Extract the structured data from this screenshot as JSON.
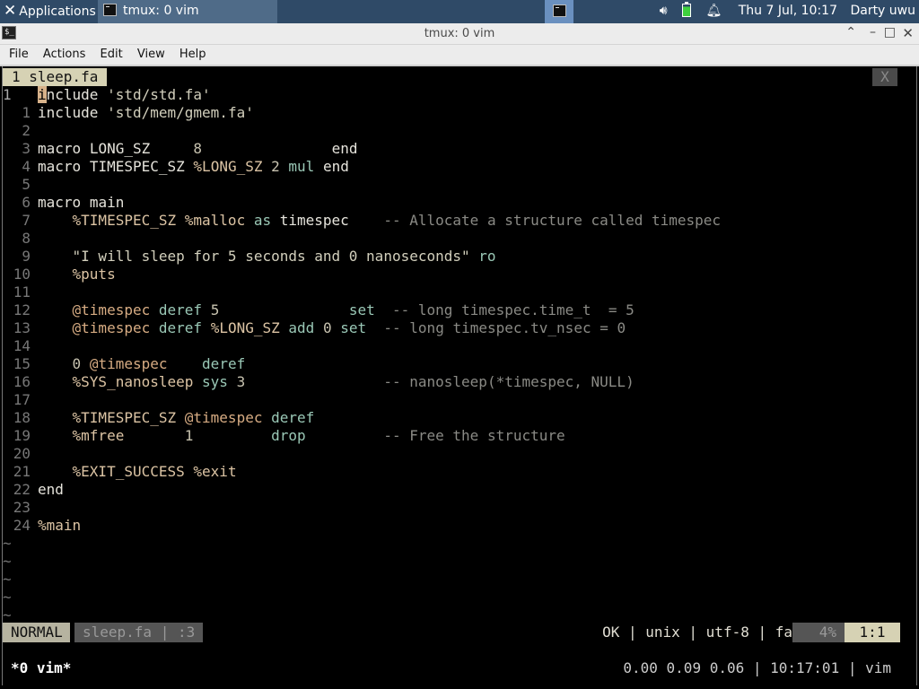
{
  "panel": {
    "apps_label": "Applications",
    "apps_icon": "xfce-mouse-x-icon",
    "task_label": "tmux: 0 vim",
    "clock": "Thu  7 Jul, 10:17",
    "user": "Darty uwu"
  },
  "window": {
    "title": "tmux: 0 vim",
    "controls": {
      "shade": "⌃",
      "minimize": "–",
      "maximize": "□",
      "close": "✕"
    }
  },
  "menubar": [
    "File",
    "Actions",
    "Edit",
    "View",
    "Help"
  ],
  "vim": {
    "tab_label": "1  sleep.fa",
    "tab_close": "X",
    "lines": [
      {
        "n": "1",
        "cur": true,
        "text": "include 'std/std.fa'"
      },
      {
        "n": "1",
        "text": "include 'std/mem/gmem.fa'"
      },
      {
        "n": "2",
        "text": ""
      },
      {
        "n": "3",
        "text": "macro LONG_SZ     8               end"
      },
      {
        "n": "4",
        "text": "macro TIMESPEC_SZ %LONG_SZ 2 mul end"
      },
      {
        "n": "5",
        "text": ""
      },
      {
        "n": "6",
        "text": "macro main"
      },
      {
        "n": "7",
        "text": "    %TIMESPEC_SZ %malloc as timespec    -- Allocate a structure called timespec"
      },
      {
        "n": "8",
        "text": ""
      },
      {
        "n": "9",
        "text": "    \"I will sleep for 5 seconds and 0 nanoseconds\" ro"
      },
      {
        "n": "10",
        "text": "    %puts"
      },
      {
        "n": "11",
        "text": ""
      },
      {
        "n": "12",
        "text": "    @timespec deref 5               set  -- long timespec.time_t  = 5"
      },
      {
        "n": "13",
        "text": "    @timespec deref %LONG_SZ add 0 set  -- long timespec.tv_nsec = 0"
      },
      {
        "n": "14",
        "text": ""
      },
      {
        "n": "15",
        "text": "    0 @timespec    deref"
      },
      {
        "n": "16",
        "text": "    %SYS_nanosleep sys 3                -- nanosleep(*timespec, NULL)"
      },
      {
        "n": "17",
        "text": ""
      },
      {
        "n": "18",
        "text": "    %TIMESPEC_SZ @timespec deref"
      },
      {
        "n": "19",
        "text": "    %mfree       1         drop         -- Free the structure"
      },
      {
        "n": "20",
        "text": ""
      },
      {
        "n": "21",
        "text": "    %EXIT_SUCCESS %exit"
      },
      {
        "n": "22",
        "text": "end"
      },
      {
        "n": "23",
        "text": ""
      },
      {
        "n": "24",
        "text": "%main"
      }
    ],
    "empty_marker": "~",
    "empty_count": 5,
    "status": {
      "mode": "NORMAL",
      "file": "sleep.fa | :3",
      "info": "OK | unix | utf-8 | fa",
      "percent": "4%",
      "position": "1:1"
    }
  },
  "tmux": {
    "window": "*0 vim*",
    "right": "0.00 0.09 0.06 | 10:17:01 | vim"
  }
}
